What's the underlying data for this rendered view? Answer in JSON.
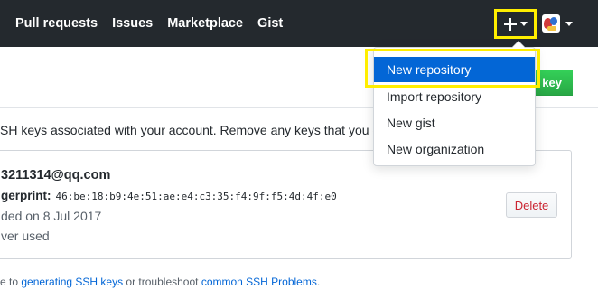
{
  "header": {
    "nav": [
      "Pull requests",
      "Issues",
      "Marketplace",
      "Gist"
    ]
  },
  "toolbar": {
    "new_key_label": "key"
  },
  "content": {
    "description": "SH keys associated with your account. Remove any keys that you do",
    "key": {
      "title": "3211314@qq.com",
      "fingerprint_label": "gerprint:",
      "fingerprint_value": "46:be:18:b9:4e:51:ae:e4:c3:35:f4:9f:f5:4d:4f:e0",
      "added": "ded on 8 Jul 2017",
      "used": "ver used",
      "delete_label": "Delete"
    },
    "footer": {
      "prefix": "e to ",
      "link1": "generating SSH keys",
      "middle": " or troubleshoot ",
      "link2": "common SSH Problems",
      "suffix": "."
    }
  },
  "dropdown": {
    "items": [
      "New repository",
      "Import repository",
      "New gist",
      "New organization"
    ],
    "active_index": 0
  },
  "colors": {
    "header_bg": "#24292e",
    "accent_blue": "#0366d6",
    "highlight_yellow": "#ffee00",
    "green": "#28a745",
    "danger": "#cb2431"
  },
  "icons": [
    "plus-icon",
    "caret-down-icon",
    "avatar"
  ]
}
